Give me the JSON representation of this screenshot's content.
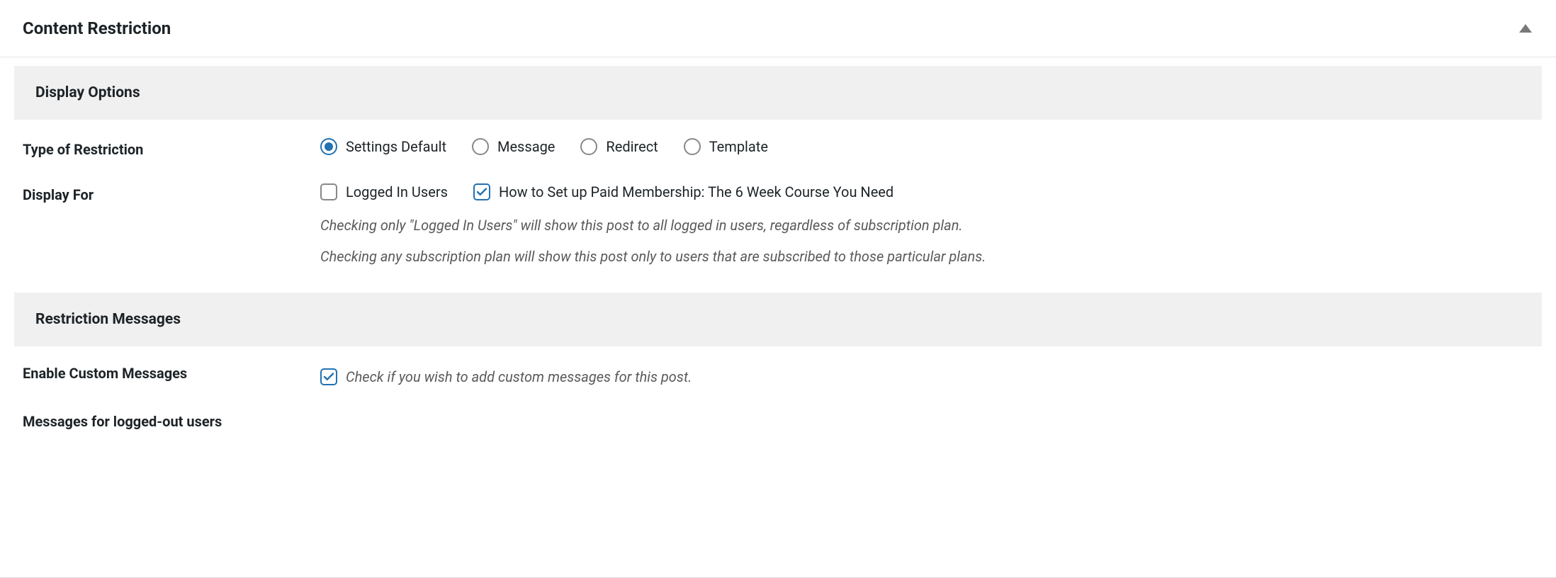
{
  "panel": {
    "title": "Content Restriction"
  },
  "sections": {
    "display_options": {
      "heading": "Display Options",
      "type_label": "Type of Restriction",
      "type_options": [
        {
          "label": "Settings Default",
          "checked": true
        },
        {
          "label": "Message",
          "checked": false
        },
        {
          "label": "Redirect",
          "checked": false
        },
        {
          "label": "Template",
          "checked": false
        }
      ],
      "display_for_label": "Display For",
      "display_for_options": [
        {
          "label": "Logged In Users",
          "checked": false
        },
        {
          "label": "How to Set up Paid Membership: The 6 Week Course You Need",
          "checked": true
        }
      ],
      "hint1": "Checking only \"Logged In Users\" will show this post to all logged in users, regardless of subscription plan.",
      "hint2": "Checking any subscription plan will show this post only to users that are subscribed to those particular plans."
    },
    "restriction_messages": {
      "heading": "Restriction Messages",
      "enable_label": "Enable Custom Messages",
      "enable_option": {
        "label": "Check if you wish to add custom messages for this post.",
        "checked": true
      },
      "logged_out_heading": "Messages for logged-out users"
    }
  }
}
